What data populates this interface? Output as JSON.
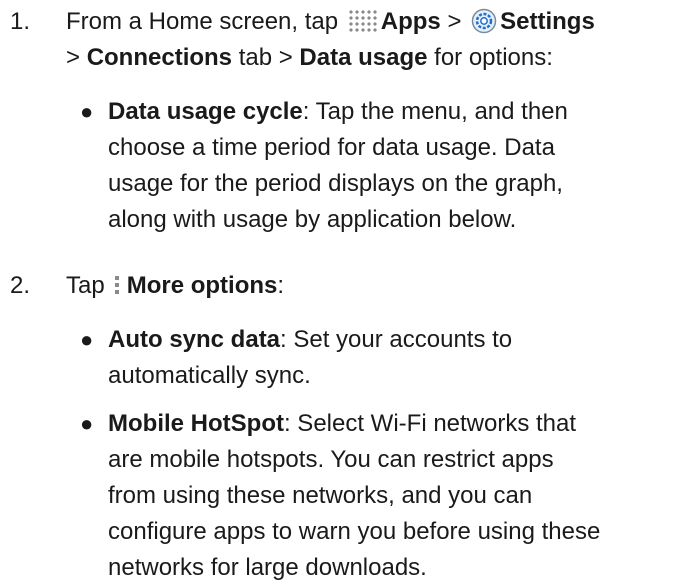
{
  "step1": {
    "number": "1.",
    "prefix": "From a Home screen, tap",
    "apps": "Apps",
    "sep1": ">",
    "settings": "Settings",
    "sep2": ">",
    "connections": "Connections",
    "tab_word": "tab >",
    "data_usage": "Data usage",
    "suffix": "for options:",
    "bullet": {
      "title": "Data usage cycle",
      "text_l1": ": Tap the menu, and then",
      "text_l2": "choose a time period for data usage. Data",
      "text_l3": "usage for the period displays on the graph,",
      "text_l4": "along with usage by application below."
    }
  },
  "step2": {
    "number": "2.",
    "prefix": "Tap",
    "more_options": "More options",
    "colon": ":",
    "bullets": [
      {
        "title": "Auto sync data",
        "text_l1": ": Set your accounts to",
        "text_l2": "automatically sync."
      },
      {
        "title": "Mobile HotSpot",
        "text_l1": ": Select Wi-Fi networks that",
        "text_l2": "are mobile hotspots. You can restrict apps",
        "text_l3": "from using these networks, and you can",
        "text_l4": "configure apps to warn you before using these",
        "text_l5": "networks for large downloads."
      }
    ]
  },
  "icons": {
    "apps": "apps-grid-icon",
    "settings": "settings-gear-icon",
    "more": "more-options-icon",
    "accent": "#1e6fd0"
  }
}
